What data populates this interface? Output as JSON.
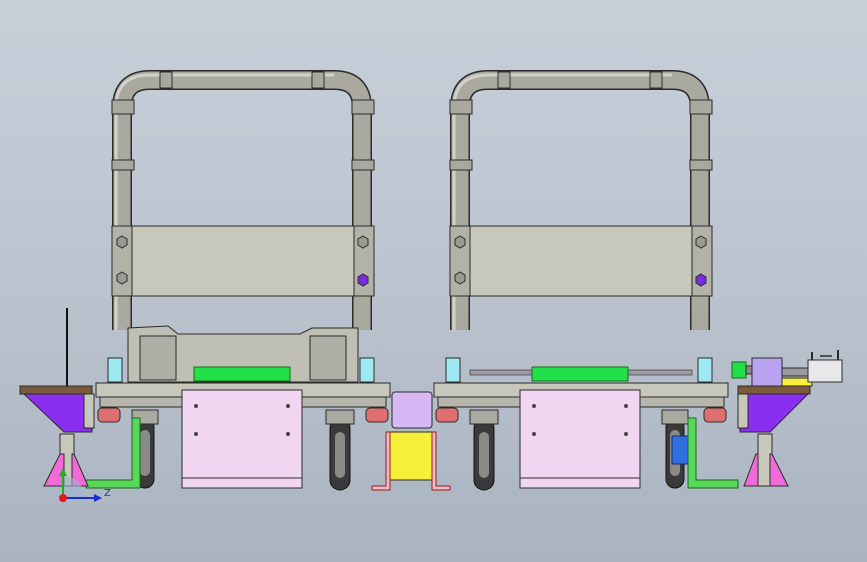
{
  "viewport": {
    "background_top": "#c8d0da",
    "background_bottom": "#aab4c1"
  },
  "triad": {
    "labels": {
      "z": "Z"
    },
    "colors": {
      "x": "#e01919",
      "y": "#19b219",
      "z": "#1a2bd8"
    }
  },
  "colors": {
    "frame_tube": "#a9a9a0",
    "panel": "#c7c7bc",
    "edge": "#2b2b2b",
    "green": "#22e04a",
    "pink_panel": "#f1d6f2",
    "violet": "#8a2ff0",
    "magenta": "#f06ad8",
    "yellow": "#f6f03a",
    "lavender": "#d7b8f4",
    "blue_motor": "#2f6fe0",
    "wood": "#7b5a3a",
    "red_caster": "#e07070",
    "wheel": "#3a3a3a"
  },
  "components": [
    "left-cart-frame",
    "right-cart-frame",
    "left-side-bracket",
    "right-side-bracket",
    "center-yellow-box",
    "center-lavender-box",
    "right-drive-motor"
  ]
}
